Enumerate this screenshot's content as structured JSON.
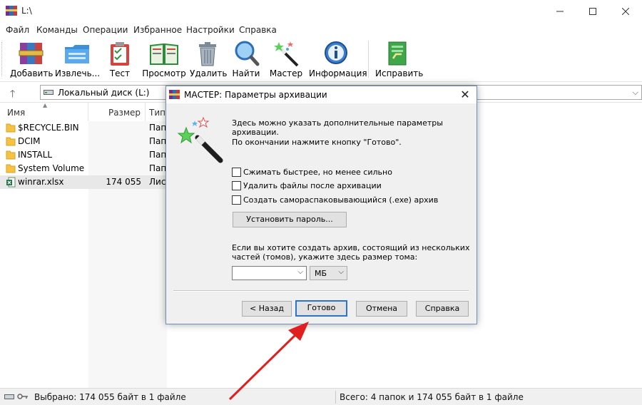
{
  "window": {
    "title": "L:\\"
  },
  "menu": [
    "Файл",
    "Команды",
    "Операции",
    "Избранное",
    "Настройки",
    "Справка"
  ],
  "toolbar": {
    "add": "Добавить",
    "extract": "Извлечь...",
    "test": "Тест",
    "view": "Просмотр",
    "delete": "Удалить",
    "find": "Найти",
    "wizard": "Мастер",
    "info": "Информация",
    "repair": "Исправить"
  },
  "address": {
    "path": "Локальный диск (L:)"
  },
  "columns": {
    "name": "Имя",
    "size": "Размер",
    "type": "Тип"
  },
  "files": [
    {
      "name": "$RECYCLE.BIN",
      "size": "",
      "type": "Пап"
    },
    {
      "name": "DCIM",
      "size": "",
      "type": "Пап"
    },
    {
      "name": "INSTALL",
      "size": "",
      "type": "Пап"
    },
    {
      "name": "System Volume I...",
      "size": "",
      "type": "Пап"
    },
    {
      "name": "winrar.xlsx",
      "size": "174 055",
      "type": "Лист"
    }
  ],
  "status": {
    "left": "Выбрано: 174 055 байт в 1 файле",
    "right": "Всего: 4 папок и 174 055 байт в 1 файле"
  },
  "dialog": {
    "title": "МАСТЕР:  Параметры архивации",
    "intro1": "Здесь можно указать дополнительные параметры архивации.",
    "intro2": "По окончании нажмите кнопку \"Готово\".",
    "options": [
      "Сжимать быстрее, но менее сильно",
      "Удалить файлы после архивации",
      "Создать самораспаковывающийся (.exe) архив"
    ],
    "password_button": "Установить пароль...",
    "volume_text1": "Если вы хотите создать архив, состоящий из нескольких",
    "volume_text2": "частей (томов), укажите здесь размер тома:",
    "volume_size_value": "",
    "volume_unit": "МБ",
    "buttons": {
      "back": "< Назад",
      "finish": "Готово",
      "cancel": "Отмена",
      "help": "Справка"
    }
  },
  "colors": {
    "annotation_arrow": "#e02020",
    "default_button_border": "#2b73d0",
    "folder": "#f5c242"
  }
}
